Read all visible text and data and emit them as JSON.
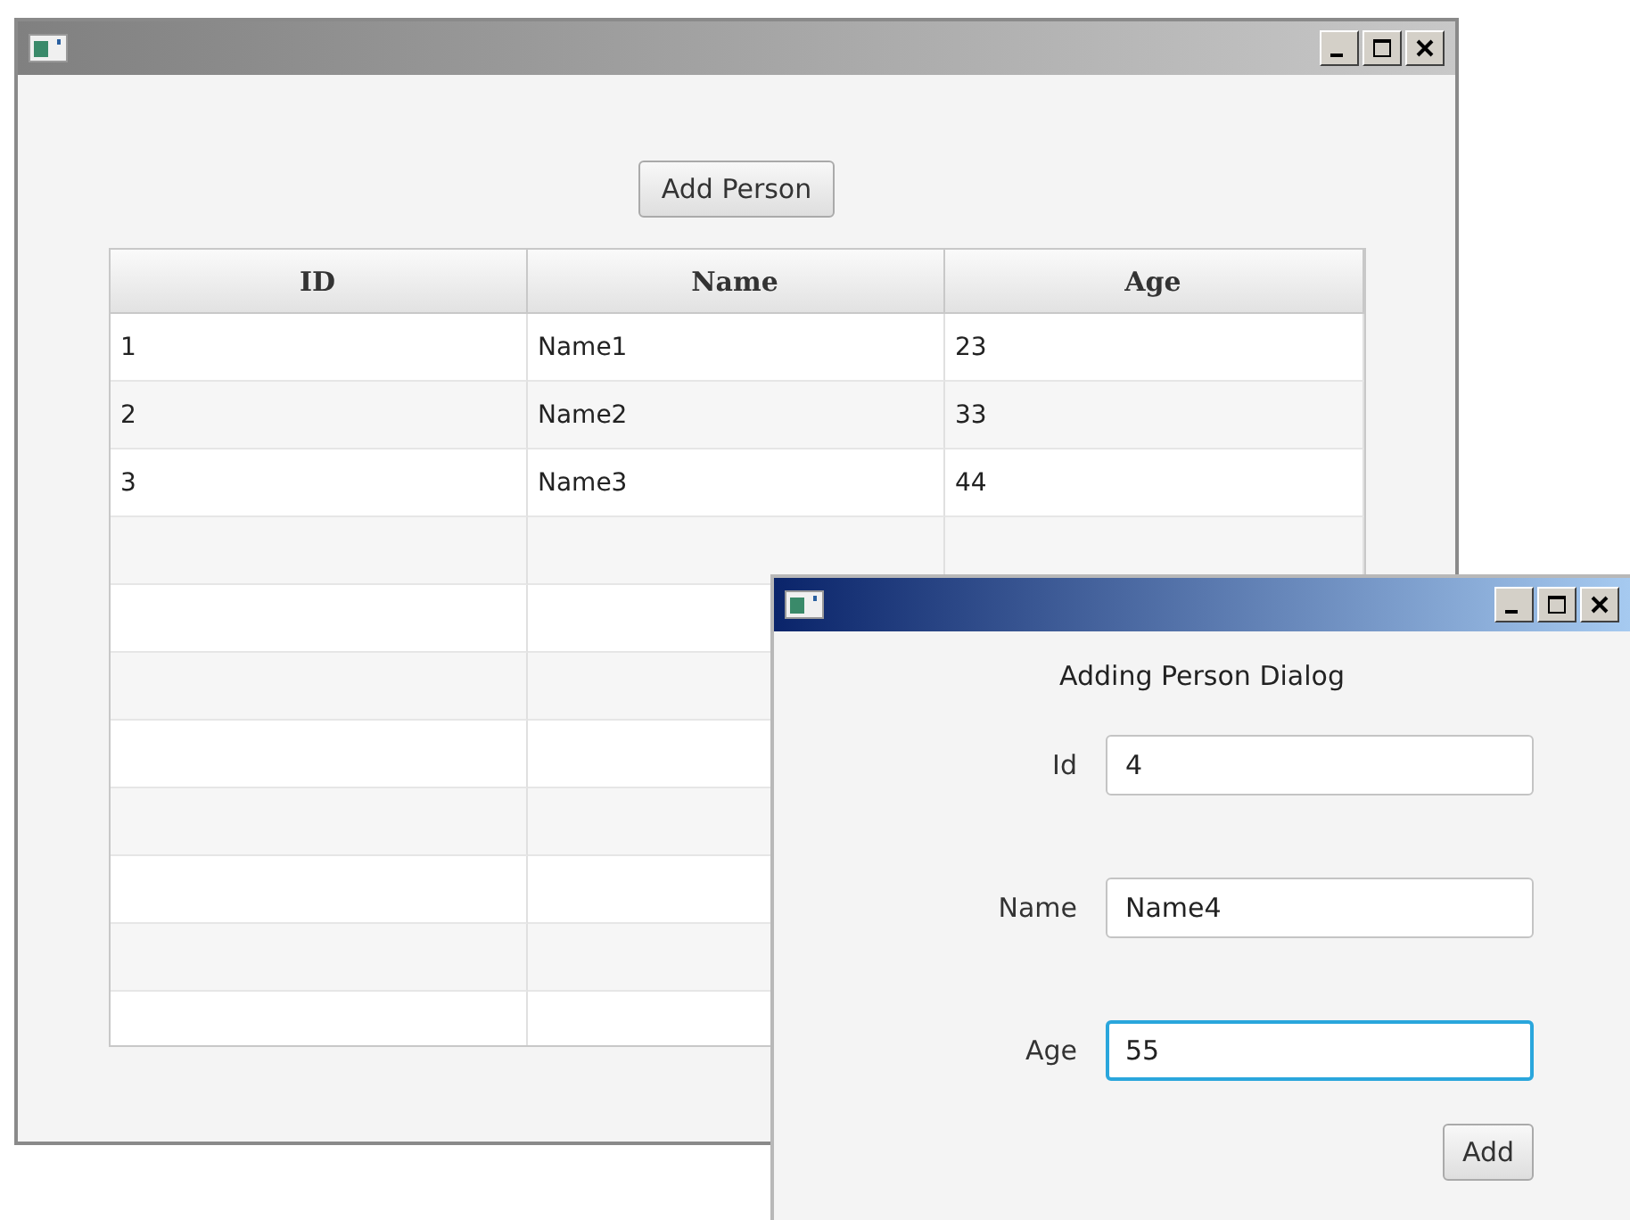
{
  "main_window": {
    "active": false,
    "add_button": "Add Person",
    "table": {
      "columns": [
        "ID",
        "Name",
        "Age"
      ],
      "rows": [
        [
          "1",
          "Name1",
          "23"
        ],
        [
          "2",
          "Name2",
          "33"
        ],
        [
          "3",
          "Name3",
          "44"
        ]
      ]
    }
  },
  "dialog": {
    "active": true,
    "heading": "Adding Person Dialog",
    "fields": [
      {
        "label": "Id",
        "value": "4",
        "focused": false
      },
      {
        "label": "Name",
        "value": "Name4",
        "focused": false
      },
      {
        "label": "Age",
        "value": "55",
        "focused": true
      }
    ],
    "add_button": "Add"
  }
}
